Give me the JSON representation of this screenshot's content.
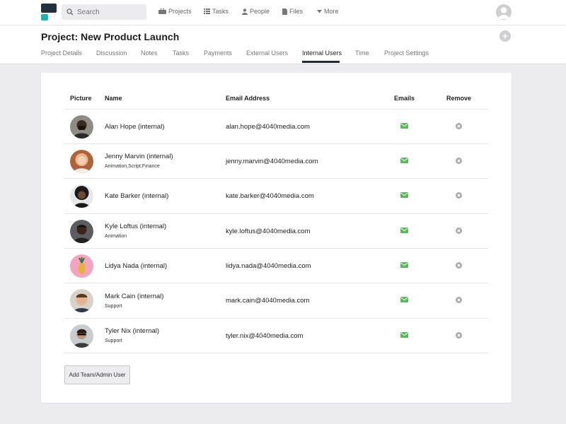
{
  "search": {
    "placeholder": "Search"
  },
  "nav": {
    "projects": "Projects",
    "tasks": "Tasks",
    "people": "People",
    "files": "Files",
    "more": "More"
  },
  "project": {
    "title": "Project: New Product Launch"
  },
  "tabs": [
    "Project Details",
    "Discussion",
    "Notes",
    "Tasks",
    "Payments",
    "External Users",
    "Internal Users",
    "Time",
    "Project Settings"
  ],
  "active_tab": "Internal Users",
  "table": {
    "headers": {
      "picture": "Picture",
      "name": "Name",
      "email": "Email Address",
      "emails": "Emails",
      "remove": "Remove"
    },
    "rows": [
      {
        "name": "Alan Hope (internal)",
        "tags": "",
        "email": "alan.hope@4040media.com"
      },
      {
        "name": "Jenny Marvin (internal)",
        "tags": "Animation,Script,Finance",
        "email": "jenny.marvin@4040media.com"
      },
      {
        "name": "Kate Barker (internal)",
        "tags": "",
        "email": "kate.barker@4040media.com"
      },
      {
        "name": "Kyle Loftus (internal)",
        "tags": "Animation",
        "email": "kyle.loftus@4040media.com"
      },
      {
        "name": "Lidya Nada (internal)",
        "tags": "",
        "email": "lidya.nada@4040media.com"
      },
      {
        "name": "Mark Cain (internal)",
        "tags": "Support",
        "email": "mark.cain@4040media.com"
      },
      {
        "name": "Tyler Nix (internal)",
        "tags": "Support",
        "email": "tyler.nix@4040media.com"
      }
    ]
  },
  "add_button": "Add Team/Admin User",
  "icons": {
    "search": "search-icon",
    "projects": "briefcase-icon",
    "tasks": "list-icon",
    "people": "person-icon",
    "files": "file-icon",
    "more": "caret-down-icon",
    "user": "user-avatar-icon",
    "add": "plus-circle-icon",
    "email": "envelope-icon",
    "remove": "remove-circle-icon"
  },
  "colors": {
    "brand_dark": "#22303f",
    "brand_teal": "#1db5b0",
    "email_green": "#5cb85c",
    "remove_gray": "#a9a9a9",
    "tab_underline": "#222d3a"
  }
}
